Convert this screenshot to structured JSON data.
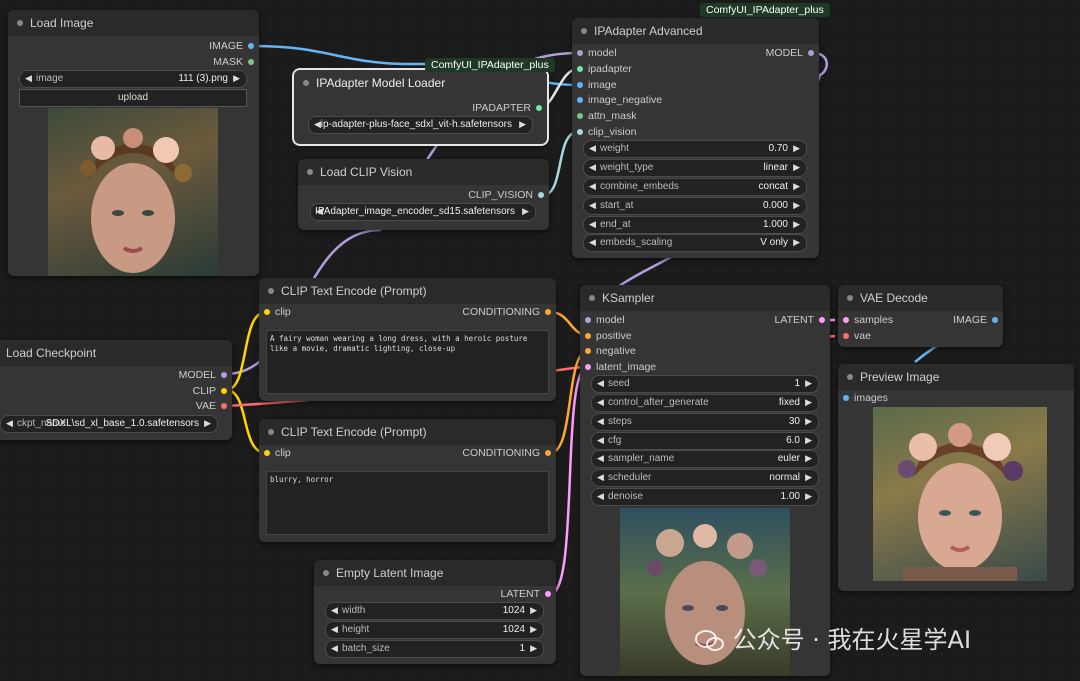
{
  "colors": {
    "model": "#b39ddb",
    "clip": "#ffd500",
    "vae": "#ff6e6e",
    "conditioning": "#ffa931",
    "latent": "#ff9cf9",
    "image": "#64b5f6",
    "mask": "#81c784",
    "ipadapter": "#6ee7a8",
    "clip_vision": "#a8dadc"
  },
  "group_labels": {
    "top": "ComfyUI_IPAdapter_plus",
    "mid": "ComfyUI_IPAdapter_plus"
  },
  "load_image": {
    "title": "Load Image",
    "out_image": "IMAGE",
    "out_mask": "MASK",
    "w_image_label": "image",
    "w_image_value": "111 (3).png",
    "upload": "upload"
  },
  "ipa_loader": {
    "title": "IPAdapter Model Loader",
    "out": "IPADAPTER",
    "w_value": "ip-adapter-plus-face_sdxl_vit-h.safetensors"
  },
  "clip_vision_loader": {
    "title": "Load CLIP Vision",
    "out": "CLIP_VISION",
    "w_value": "IPAdapter_image_encoder_sd15.safetensors"
  },
  "ipa_adv": {
    "title": "IPAdapter Advanced",
    "out": "MODEL",
    "inputs": [
      "model",
      "ipadapter",
      "image",
      "image_negative",
      "attn_mask",
      "clip_vision"
    ],
    "widgets": [
      {
        "label": "weight",
        "value": "0.70"
      },
      {
        "label": "weight_type",
        "value": "linear"
      },
      {
        "label": "combine_embeds",
        "value": "concat"
      },
      {
        "label": "start_at",
        "value": "0.000"
      },
      {
        "label": "end_at",
        "value": "1.000"
      },
      {
        "label": "embeds_scaling",
        "value": "V only"
      }
    ]
  },
  "checkpoint": {
    "title": "Load Checkpoint",
    "out_model": "MODEL",
    "out_clip": "CLIP",
    "out_vae": "VAE",
    "w_label": "ckpt_name",
    "w_value": "SDXL\\sd_xl_base_1.0.safetensors"
  },
  "clip_pos": {
    "title": "CLIP Text Encode (Prompt)",
    "in": "clip",
    "out": "CONDITIONING",
    "text": "A fairy woman wearing a long dress, with a heroic posture like a movie, dramatic lighting, close-up"
  },
  "clip_neg": {
    "title": "CLIP Text Encode (Prompt)",
    "in": "clip",
    "out": "CONDITIONING",
    "text": "blurry, horror"
  },
  "latent": {
    "title": "Empty Latent Image",
    "out": "LATENT",
    "widgets": [
      {
        "label": "width",
        "value": "1024"
      },
      {
        "label": "height",
        "value": "1024"
      },
      {
        "label": "batch_size",
        "value": "1"
      }
    ]
  },
  "ksampler": {
    "title": "KSampler",
    "out": "LATENT",
    "inputs": [
      "model",
      "positive",
      "negative",
      "latent_image"
    ],
    "widgets": [
      {
        "label": "seed",
        "value": "1"
      },
      {
        "label": "control_after_generate",
        "value": "fixed"
      },
      {
        "label": "steps",
        "value": "30"
      },
      {
        "label": "cfg",
        "value": "6.0"
      },
      {
        "label": "sampler_name",
        "value": "euler"
      },
      {
        "label": "scheduler",
        "value": "normal"
      },
      {
        "label": "denoise",
        "value": "1.00"
      }
    ]
  },
  "vae_decode": {
    "title": "VAE Decode",
    "in_samples": "samples",
    "in_vae": "vae",
    "out": "IMAGE"
  },
  "preview": {
    "title": "Preview Image",
    "in": "images"
  },
  "watermark": "公众号 · 我在火星学AI"
}
